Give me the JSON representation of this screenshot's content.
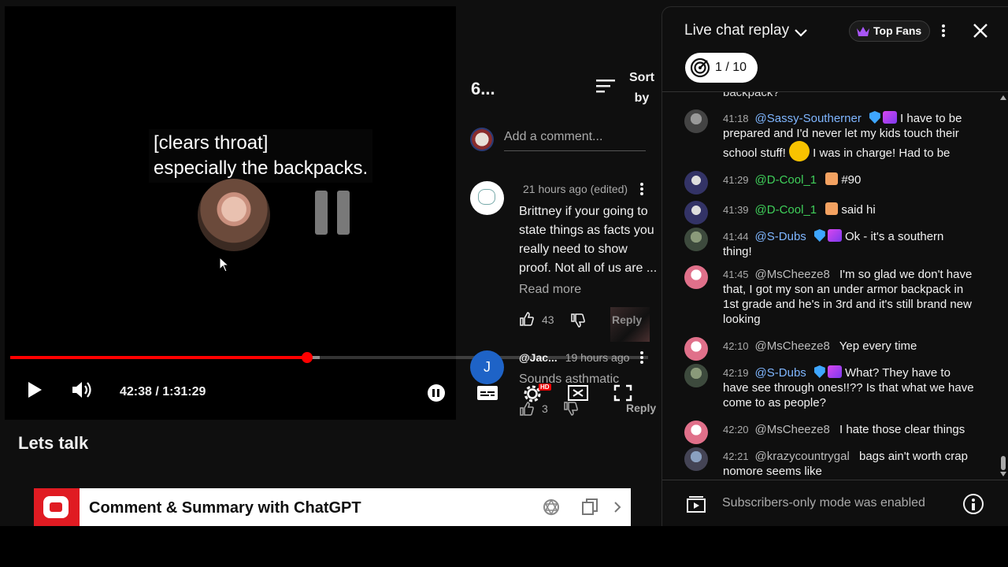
{
  "video": {
    "caption_line1": "[clears throat]",
    "caption_line2": "especially the backpacks.",
    "current_time": "42:38",
    "duration": "1:31:29",
    "time_display": "42:38 / 1:31:29",
    "progress_fraction": 0.4658,
    "buffered_fraction": 0.485
  },
  "page": {
    "title": "Lets talk"
  },
  "extension": {
    "title": "Comment & Summary with ChatGPT"
  },
  "comments": {
    "count_label": "6...",
    "sort_label_1": "Sort",
    "sort_label_2": "by",
    "add_placeholder": "Add a comment...",
    "items": [
      {
        "meta": "21 hours ago (edited)",
        "text": "Brittney if your going to state things as facts you really need to show proof. Not all of us are ...",
        "read_more": "Read more",
        "likes": "43",
        "reply": "Reply"
      },
      {
        "avatar_letter": "J",
        "author": "@Jac...",
        "meta": "19 hours ago",
        "text": "Sounds asthmatic",
        "likes": "3",
        "reply": "Reply"
      }
    ]
  },
  "chat": {
    "title": "Live chat replay",
    "top_fans": "Top Fans",
    "goal_progress": "1 / 10",
    "cutoff_text": "backpack?",
    "footer_text": "Subscribers-only mode was enabled",
    "messages": [
      {
        "time": "41:18",
        "author": "@Sassy-Southerner",
        "text1": "I have to be prepared and I'd never let my kids touch their school stuff!",
        "text2": "I was in charge! Had to be"
      },
      {
        "time": "41:29",
        "author": "@D-Cool_1",
        "text": "#90"
      },
      {
        "time": "41:39",
        "author": "@D-Cool_1",
        "text": "said hi"
      },
      {
        "time": "41:44",
        "author": "@S-Dubs",
        "text": "Ok - it's a southern thing!"
      },
      {
        "time": "41:45",
        "author": "@MsCheeze8",
        "text": "I'm so glad we don't have that, I got my son an under armor backpack in 1st grade and he's in 3rd and it's still brand new looking"
      },
      {
        "time": "42:10",
        "author": "@MsCheeze8",
        "text": "Yep every time"
      },
      {
        "time": "42:19",
        "author": "@S-Dubs",
        "text": "What? They have to have see through ones!!?? Is that what we have come to as people?"
      },
      {
        "time": "42:20",
        "author": "@MsCheeze8",
        "text": "I hate those clear things"
      },
      {
        "time": "42:21",
        "author": "@krazycountrygal",
        "text": "bags ain't worth crap nomore seems like"
      }
    ]
  },
  "colors": {
    "progress": "#ff0000",
    "mod_badge": "#3ea6ff",
    "author_green": "#3fd05a",
    "author_blue": "#7fb6ff"
  }
}
